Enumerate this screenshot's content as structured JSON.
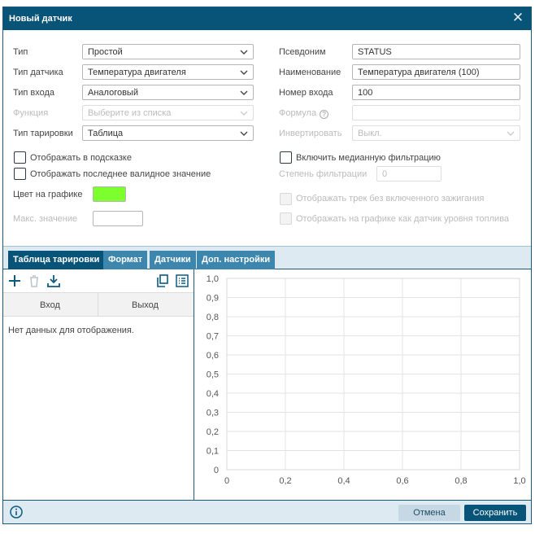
{
  "dialog": {
    "title": "Новый датчик"
  },
  "left_fields": [
    {
      "label": "Тип",
      "value": "Простой",
      "disabled": false
    },
    {
      "label": "Тип датчика",
      "value": "Температура двигателя",
      "disabled": false
    },
    {
      "label": "Тип входа",
      "value": "Аналоговый",
      "disabled": false
    },
    {
      "label": "Функция",
      "value": "Выберите из списка",
      "disabled": true
    },
    {
      "label": "Тип тарировки",
      "value": "Таблица",
      "disabled": false
    }
  ],
  "right_fields": {
    "alias": {
      "label": "Псевдоним",
      "value": "STATUS"
    },
    "name": {
      "label": "Наименование",
      "value": "Температура двигателя (100)"
    },
    "input_number": {
      "label": "Номер входа",
      "value": "100"
    },
    "formula": {
      "label": "Формула",
      "value": "",
      "help": "?"
    },
    "invert": {
      "label": "Инвертировать",
      "value": "Выкл."
    }
  },
  "checkboxes": {
    "show_in_tooltip": {
      "label": "Отображать в подсказке",
      "checked": false
    },
    "show_last_valid": {
      "label": "Отображать последнее валидное значение",
      "checked": false
    },
    "median_filter": {
      "label": "Включить медианную фильтрацию",
      "checked": false
    },
    "show_track_no_ignition": {
      "label": "Отображать трек без включенного зажигания",
      "disabled": true
    },
    "show_as_fuel": {
      "label": "Отображать на графике как датчик уровня топлива",
      "disabled": true
    }
  },
  "filter_degree": {
    "label": "Степень фильтрации",
    "value": "0"
  },
  "graph_color": {
    "label": "Цвет на графике",
    "color": "#7dff2d"
  },
  "max_value": {
    "label": "Макс. значение",
    "value": ""
  },
  "tabs": [
    {
      "label": "Таблица тарировки",
      "active": true
    },
    {
      "label": "Формат",
      "active": false
    },
    {
      "label": "Датчики",
      "active": false
    },
    {
      "label": "Доп. настройки",
      "active": false
    }
  ],
  "table": {
    "columns": [
      "Вход",
      "Выход"
    ],
    "empty_text": "Нет данных для отображения."
  },
  "toolbar_icons": [
    "add-icon",
    "delete-icon",
    "download-icon",
    "copy-icon",
    "list-icon"
  ],
  "chart_data": {
    "type": "line",
    "series": [],
    "xlim": [
      0,
      1
    ],
    "ylim": [
      0,
      1
    ],
    "x_ticks": [
      "0",
      "0,2",
      "0,4",
      "0,6",
      "0,8",
      "1,0"
    ],
    "y_ticks": [
      "0",
      "0,1",
      "0,2",
      "0,3",
      "0,4",
      "0,5",
      "0,6",
      "0,7",
      "0,8",
      "0,9",
      "1,0"
    ],
    "grid": true
  },
  "footer": {
    "cancel_label": "Отмена",
    "save_label": "Сохранить"
  },
  "colors": {
    "accent": "#075478",
    "tab": "#3d86ad",
    "strip": "#ddeaf1"
  }
}
